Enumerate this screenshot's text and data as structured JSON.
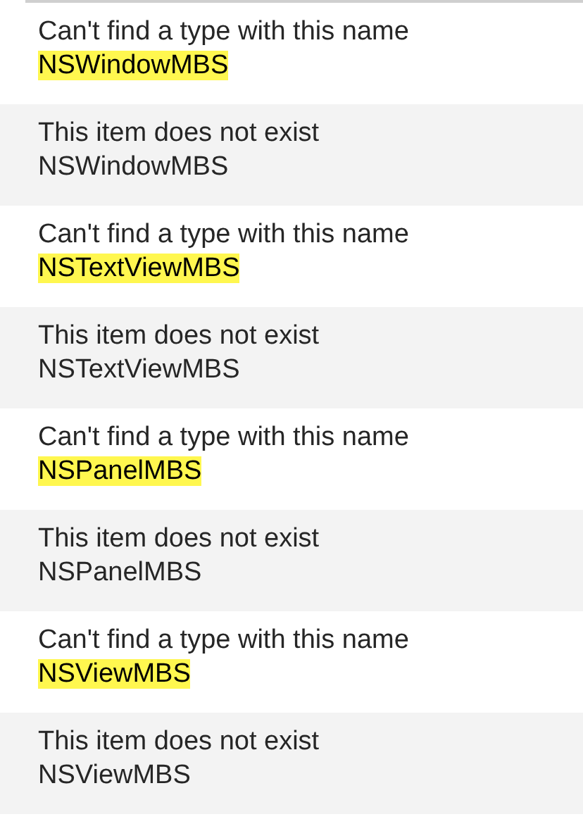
{
  "messages": [
    {
      "text": "Can't find a type with this name",
      "name": "NSWindowMBS",
      "highlighted": true
    },
    {
      "text": "This item does not exist",
      "name": "NSWindowMBS",
      "highlighted": false
    },
    {
      "text": "Can't find a type with this name",
      "name": "NSTextViewMBS",
      "highlighted": true
    },
    {
      "text": "This item does not exist",
      "name": "NSTextViewMBS",
      "highlighted": false
    },
    {
      "text": "Can't find a type with this name",
      "name": "NSPanelMBS",
      "highlighted": true
    },
    {
      "text": "This item does not exist",
      "name": "NSPanelMBS",
      "highlighted": false
    },
    {
      "text": "Can't find a type with this name",
      "name": "NSViewMBS",
      "highlighted": true
    },
    {
      "text": "This item does not exist",
      "name": "NSViewMBS",
      "highlighted": false
    }
  ]
}
